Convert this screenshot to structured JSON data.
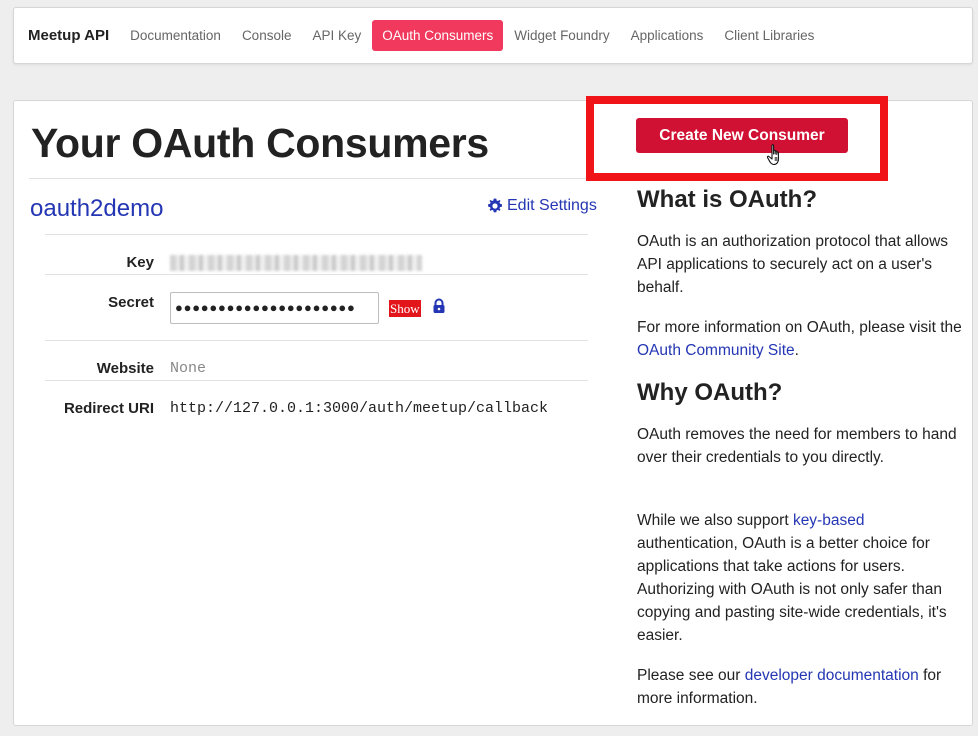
{
  "nav": {
    "brand": "Meetup API",
    "items": [
      {
        "label": "Documentation",
        "active": false
      },
      {
        "label": "Console",
        "active": false
      },
      {
        "label": "API Key",
        "active": false
      },
      {
        "label": "OAuth Consumers",
        "active": true
      },
      {
        "label": "Widget Foundry",
        "active": false
      },
      {
        "label": "Applications",
        "active": false
      },
      {
        "label": "Client Libraries",
        "active": false
      }
    ]
  },
  "page": {
    "title": "Your OAuth Consumers"
  },
  "consumer": {
    "name": "oauth2demo",
    "edit_label": "Edit Settings",
    "fields": {
      "key_label": "Key",
      "secret_label": "Secret",
      "secret_value": "●●●●●●●●●●●●●●●●●●●●●",
      "show_label": "Show",
      "website_label": "Website",
      "website_value": "None",
      "redirect_label": "Redirect URI",
      "redirect_value": "http://127.0.0.1:3000/auth/meetup/callback"
    }
  },
  "sidebar": {
    "create_button": "Create New Consumer",
    "what_heading": "What is OAuth?",
    "what_p1": "OAuth is an authorization protocol that allows API applications to securely act on a user's behalf.",
    "what_p2_pre": "For more information on OAuth, please visit the ",
    "what_p2_link": "OAuth Community Site",
    "what_p2_post": ".",
    "why_heading": "Why OAuth?",
    "why_p1": "OAuth removes the need for members to hand over their credentials to you directly.",
    "why_p2_pre": "While we also support ",
    "why_p2_link": "key-based",
    "why_p2_post": " authentication, OAuth is a better choice for applications that take actions for users. Authorizing with OAuth is not only safer than copying and pasting site-wide credentials, it's easier.",
    "why_p3_pre": "Please see our ",
    "why_p3_link": "developer documentation",
    "why_p3_post": " for more information."
  },
  "colors": {
    "accent": "#f0395c",
    "link": "#2436b3",
    "create_button": "#d11133",
    "highlight": "#f01418"
  }
}
